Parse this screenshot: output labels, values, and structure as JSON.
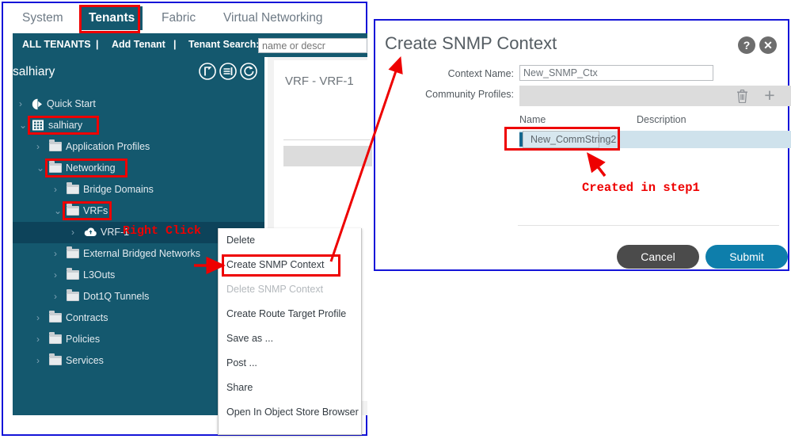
{
  "apic": {
    "nav_tabs": [
      {
        "label": "System",
        "active": false
      },
      {
        "label": "Tenants",
        "active": true
      },
      {
        "label": "Fabric",
        "active": false
      },
      {
        "label": "Virtual Networking",
        "active": false
      }
    ],
    "tenant_bar": {
      "all_tenants": "ALL TENANTS",
      "sep1": "|",
      "add_tenant": "Add Tenant",
      "sep2": "|",
      "tenant_search_label": "Tenant Search:",
      "search_placeholder": "name or descr",
      "search_value": ""
    },
    "sidebar": {
      "tenant_name": "salhiary",
      "head_icons": [
        "collapse-icon",
        "list-icon",
        "refresh-icon"
      ],
      "tree": [
        {
          "label": "Quick Start",
          "indent": 0,
          "icon": "quickstart-icon",
          "chev": "›",
          "selected": false,
          "highlight": false
        },
        {
          "label": "salhiary",
          "indent": 0,
          "icon": "tenant-icon",
          "chev": "⌄",
          "selected": false,
          "highlight": true
        },
        {
          "label": "Application Profiles",
          "indent": 1,
          "icon": "folder-icon",
          "chev": "›",
          "selected": false,
          "highlight": false
        },
        {
          "label": "Networking",
          "indent": 1,
          "icon": "folder-icon",
          "chev": "⌄",
          "selected": false,
          "highlight": true
        },
        {
          "label": "Bridge Domains",
          "indent": 2,
          "icon": "folder-icon",
          "chev": "›",
          "selected": false,
          "highlight": false
        },
        {
          "label": "VRFs",
          "indent": 2,
          "icon": "folder-icon",
          "chev": "⌄",
          "selected": false,
          "highlight": true
        },
        {
          "label": "VRF-1",
          "indent": 3,
          "icon": "vrf-cloud-icon",
          "chev": "›",
          "selected": true,
          "highlight": false
        },
        {
          "label": "External Bridged Networks",
          "indent": 2,
          "icon": "folder-icon",
          "chev": "›",
          "selected": false,
          "highlight": false
        },
        {
          "label": "L3Outs",
          "indent": 2,
          "icon": "folder-icon",
          "chev": "›",
          "selected": false,
          "highlight": false
        },
        {
          "label": "Dot1Q Tunnels",
          "indent": 2,
          "icon": "folder-icon",
          "chev": "›",
          "selected": false,
          "highlight": false
        },
        {
          "label": "Contracts",
          "indent": 1,
          "icon": "folder-icon",
          "chev": "›",
          "selected": false,
          "highlight": false
        },
        {
          "label": "Policies",
          "indent": 1,
          "icon": "folder-icon",
          "chev": "›",
          "selected": false,
          "highlight": false
        },
        {
          "label": "Services",
          "indent": 1,
          "icon": "folder-icon",
          "chev": "›",
          "selected": false,
          "highlight": false
        }
      ]
    },
    "content_panel": {
      "title": "VRF - VRF-1"
    },
    "context_menu": {
      "items": [
        {
          "label": "Delete",
          "disabled": false,
          "highlight": false
        },
        {
          "label": "Create SNMP Context",
          "disabled": false,
          "highlight": true
        },
        {
          "label": "Delete SNMP Context",
          "disabled": true,
          "highlight": false
        },
        {
          "label": "Create Route Target Profile",
          "disabled": false,
          "highlight": false
        },
        {
          "label": "Save as ...",
          "disabled": false,
          "highlight": false
        },
        {
          "label": "Post ...",
          "disabled": false,
          "highlight": false
        },
        {
          "label": "Share",
          "disabled": false,
          "highlight": false
        },
        {
          "label": "Open In Object Store Browser",
          "disabled": false,
          "highlight": false
        }
      ]
    }
  },
  "dialog": {
    "title": "Create SNMP Context",
    "help_glyph": "?",
    "close_glyph": "✕",
    "context_name_label": "Context Name:",
    "context_name_value": "New_SNMP_Ctx",
    "community_profiles_label": "Community Profiles:",
    "toolbar_icons": [
      "trash-icon",
      "plus-icon"
    ],
    "plus_glyph": "+",
    "table": {
      "columns": [
        "Name",
        "Description"
      ],
      "rows": [
        {
          "name": "New_CommString2",
          "description": ""
        }
      ]
    },
    "cancel_label": "Cancel",
    "submit_label": "Submit"
  },
  "annotations": {
    "right_click": "Right Click",
    "created_in_step1": "Created in step1"
  },
  "colors": {
    "accent_teal": "#14586e",
    "submit_blue": "#0e7eab",
    "cancel_grey": "#4b4b4b",
    "annotation_red": "#ee0000",
    "window_border_blue": "#1414d8",
    "row_highlight": "#cfe2ec"
  }
}
